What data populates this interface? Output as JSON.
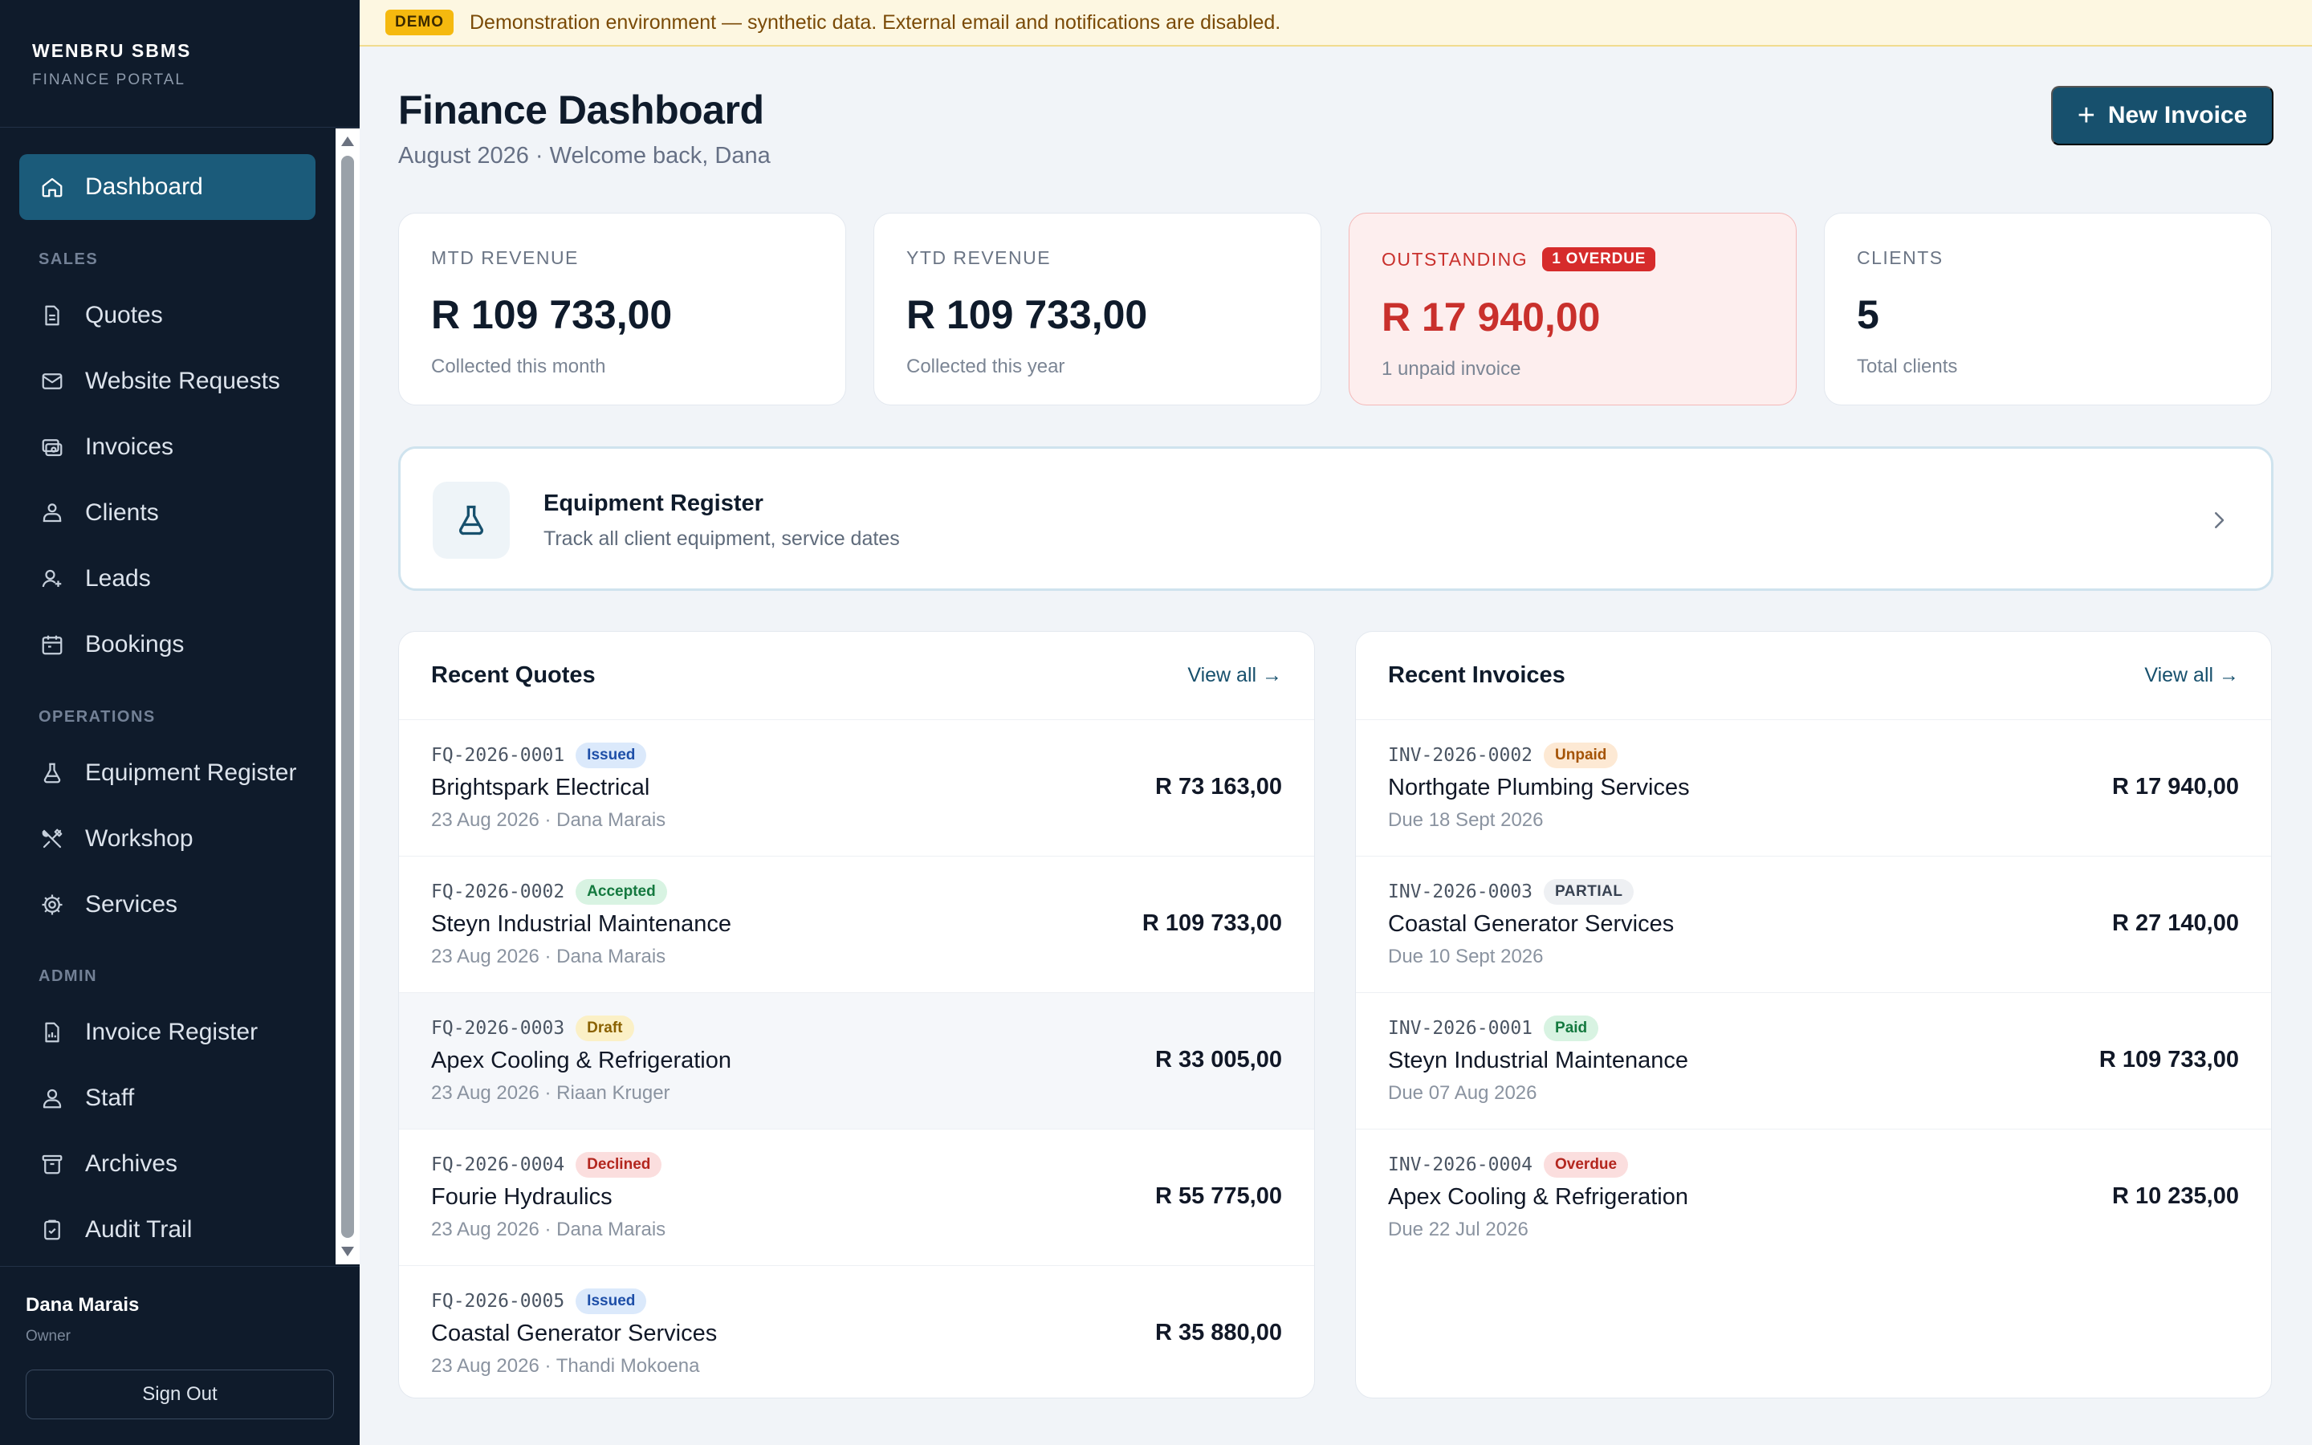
{
  "app": {
    "name": "WENBRU SBMS",
    "subtitle": "FINANCE PORTAL"
  },
  "sidebar": {
    "active": {
      "label": "Dashboard",
      "icon": "home-icon"
    },
    "sections": {
      "sales": "SALES",
      "operations": "OPERATIONS",
      "admin": "ADMIN"
    },
    "sales_items": [
      {
        "label": "Quotes",
        "icon": "document-icon"
      },
      {
        "label": "Website Requests",
        "icon": "mail-icon"
      },
      {
        "label": "Invoices",
        "icon": "invoice-icon"
      },
      {
        "label": "Clients",
        "icon": "clients-icon"
      },
      {
        "label": "Leads",
        "icon": "user-plus-icon"
      },
      {
        "label": "Bookings",
        "icon": "calendar-icon"
      }
    ],
    "operations_items": [
      {
        "label": "Equipment Register",
        "icon": "flask-icon"
      },
      {
        "label": "Workshop",
        "icon": "tools-icon"
      },
      {
        "label": "Services",
        "icon": "gear-icon"
      }
    ],
    "admin_items": [
      {
        "label": "Invoice Register",
        "icon": "register-icon"
      },
      {
        "label": "Staff",
        "icon": "staff-icon"
      },
      {
        "label": "Archives",
        "icon": "archive-icon"
      },
      {
        "label": "Audit Trail",
        "icon": "clipboard-icon"
      }
    ],
    "user": {
      "name": "Dana Marais",
      "role": "Owner"
    },
    "sign_out": "Sign Out"
  },
  "demo": {
    "badge": "DEMO",
    "text": "Demonstration environment — synthetic data. External email and notifications are disabled."
  },
  "header": {
    "title": "Finance Dashboard",
    "subtitle": "August 2026 · Welcome back, Dana",
    "new_invoice": "New Invoice"
  },
  "stats": [
    {
      "label": "MTD REVENUE",
      "value": "R 109 733,00",
      "note": "Collected this month"
    },
    {
      "label": "YTD REVENUE",
      "value": "R 109 733,00",
      "note": "Collected this year"
    },
    {
      "label": "OUTSTANDING",
      "badge": "1 OVERDUE",
      "value": "R 17 940,00",
      "note": "1 unpaid invoice"
    },
    {
      "label": "CLIENTS",
      "value": "5",
      "note": "Total clients"
    }
  ],
  "equipment": {
    "title": "Equipment Register",
    "subtitle": "Track all client equipment, service dates"
  },
  "quotes": {
    "title": "Recent Quotes",
    "view_all": "View all →",
    "rows": [
      {
        "code": "FQ-2026-0001",
        "status": "Issued",
        "name": "Brightspark Electrical",
        "meta": "23 Aug 2026 · Dana Marais",
        "amount": "R 73 163,00"
      },
      {
        "code": "FQ-2026-0002",
        "status": "Accepted",
        "name": "Steyn Industrial Maintenance",
        "meta": "23 Aug 2026 · Dana Marais",
        "amount": "R 109 733,00"
      },
      {
        "code": "FQ-2026-0003",
        "status": "Draft",
        "name": "Apex Cooling & Refrigeration",
        "meta": "23 Aug 2026 · Riaan Kruger",
        "amount": "R 33 005,00"
      },
      {
        "code": "FQ-2026-0004",
        "status": "Declined",
        "name": "Fourie Hydraulics",
        "meta": "23 Aug 2026 · Dana Marais",
        "amount": "R 55 775,00"
      },
      {
        "code": "FQ-2026-0005",
        "status": "Issued",
        "name": "Coastal Generator Services",
        "meta": "23 Aug 2026 · Thandi Mokoena",
        "amount": "R 35 880,00"
      }
    ]
  },
  "invoices": {
    "title": "Recent Invoices",
    "view_all": "View all →",
    "rows": [
      {
        "code": "INV-2026-0002",
        "status": "Unpaid",
        "name": "Northgate Plumbing Services",
        "meta": "Due 18 Sept 2026",
        "amount": "R 17 940,00"
      },
      {
        "code": "INV-2026-0003",
        "status": "PARTIAL",
        "name": "Coastal Generator Services",
        "meta": "Due 10 Sept 2026",
        "amount": "R 27 140,00"
      },
      {
        "code": "INV-2026-0001",
        "status": "Paid",
        "name": "Steyn Industrial Maintenance",
        "meta": "Due 07 Aug 2026",
        "amount": "R 109 733,00"
      },
      {
        "code": "INV-2026-0004",
        "status": "Overdue",
        "name": "Apex Cooling & Refrigeration",
        "meta": "Due 22 Jul 2026",
        "amount": "R 10 235,00"
      }
    ]
  },
  "colors": {
    "sidebar_bg": "#0f1b2b",
    "accent": "#17506d",
    "active_nav": "#1b5b7a",
    "danger": "#c9302c",
    "demo_badge": "#f5b90f"
  }
}
